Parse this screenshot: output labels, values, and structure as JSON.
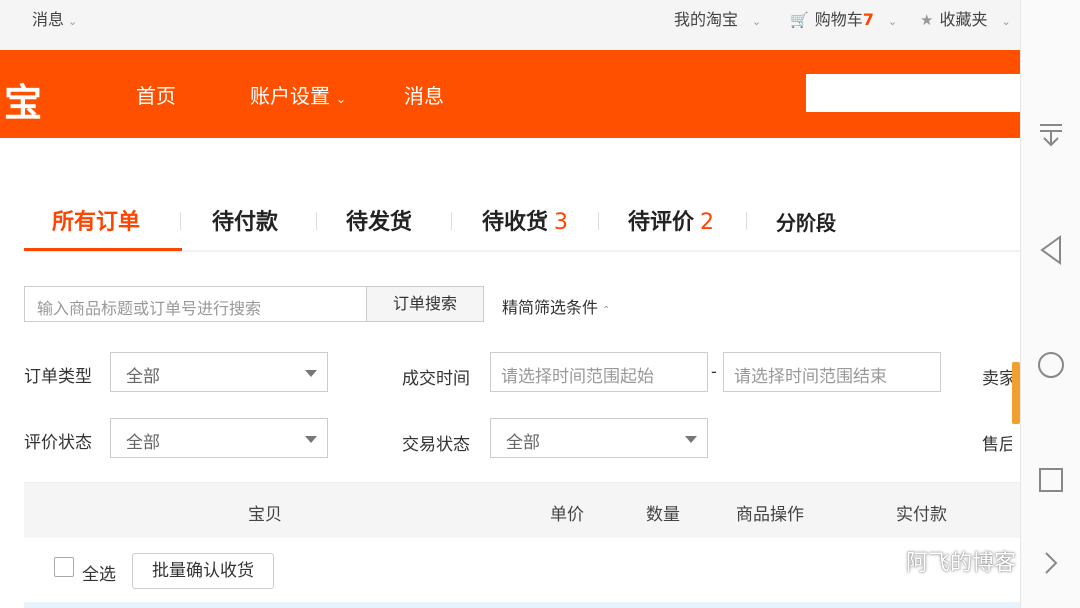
{
  "topbar": {
    "messages": "消息",
    "my_taobao": "我的淘宝",
    "cart_label": "购物车",
    "cart_count": "7",
    "favorites": "收藏夹"
  },
  "header": {
    "logo": "宝",
    "nav": [
      "首页",
      "账户设置",
      "消息"
    ],
    "brand_color": "#ff5000"
  },
  "tabs": [
    {
      "label": "所有订单",
      "count": ""
    },
    {
      "label": "待付款",
      "count": ""
    },
    {
      "label": "待发货",
      "count": ""
    },
    {
      "label": "待收货",
      "count": "3"
    },
    {
      "label": "待评价",
      "count": "2"
    },
    {
      "label": "分阶段",
      "count": ""
    }
  ],
  "search": {
    "placeholder": "输入商品标题或订单号进行搜索",
    "button": "订单搜索",
    "filter_toggle": "精简筛选条件"
  },
  "filters": {
    "order_type_label": "订单类型",
    "order_type_value": "全部",
    "deal_time_label": "成交时间",
    "start_placeholder": "请选择时间范围起始",
    "end_placeholder": "请选择时间范围结束",
    "separator": "-",
    "seller_label": "卖家",
    "review_status_label": "评价状态",
    "review_status_value": "全部",
    "trade_status_label": "交易状态",
    "trade_status_value": "全部",
    "after_sale_label": "售后"
  },
  "table": {
    "columns": [
      "宝贝",
      "单价",
      "数量",
      "商品操作",
      "实付款"
    ]
  },
  "bulk": {
    "select_all": "全选",
    "confirm_button": "批量确认收货"
  },
  "watermark": "阿飞的博客"
}
